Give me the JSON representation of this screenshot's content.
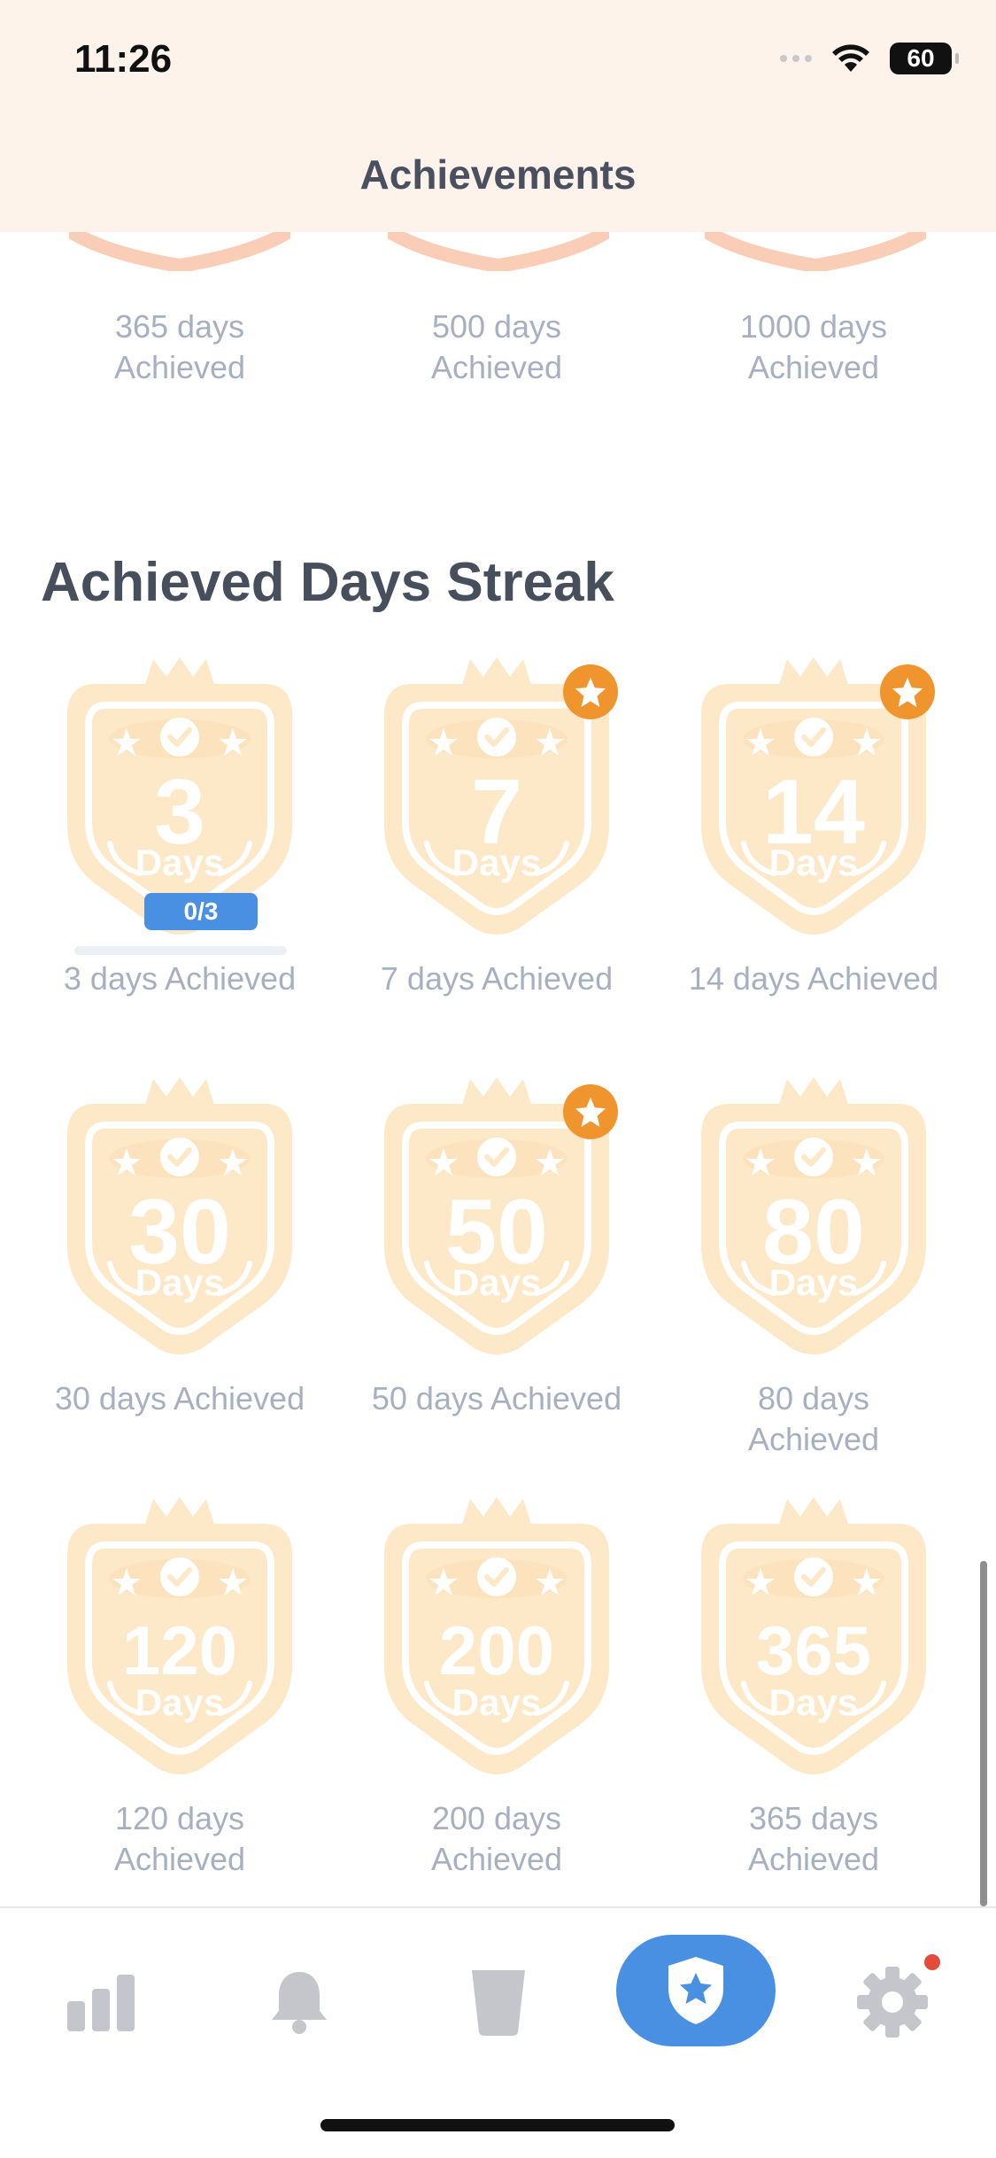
{
  "status_bar": {
    "time": "11:26",
    "battery": "60"
  },
  "header": {
    "title": "Achievements"
  },
  "previous_row": [
    {
      "label": "365 days\nAchieved"
    },
    {
      "label": "500 days\nAchieved"
    },
    {
      "label": "1000 days\nAchieved"
    }
  ],
  "section": {
    "title": "Achieved Days Streak",
    "badges": [
      {
        "number": "3",
        "unit": "Days",
        "label": "3 days Achieved",
        "starred": false,
        "progress": "0/3"
      },
      {
        "number": "7",
        "unit": "Days",
        "label": "7 days Achieved",
        "starred": true
      },
      {
        "number": "14",
        "unit": "Days",
        "label": "14 days Achieved",
        "starred": true
      },
      {
        "number": "30",
        "unit": "Days",
        "label": "30 days Achieved",
        "starred": false
      },
      {
        "number": "50",
        "unit": "Days",
        "label": "50 days Achieved",
        "starred": true
      },
      {
        "number": "80",
        "unit": "Days",
        "label": "80 days\nAchieved",
        "starred": false
      },
      {
        "number": "120",
        "unit": "Days",
        "label": "120 days\nAchieved",
        "starred": false
      },
      {
        "number": "200",
        "unit": "Days",
        "label": "200 days\nAchieved",
        "starred": false
      },
      {
        "number": "365",
        "unit": "Days",
        "label": "365 days\nAchieved",
        "starred": false
      }
    ]
  },
  "tabbar": {
    "tabs": [
      {
        "name": "stats",
        "icon": "bar-chart-icon"
      },
      {
        "name": "reminders",
        "icon": "bell-icon"
      },
      {
        "name": "drink",
        "icon": "cup-icon"
      },
      {
        "name": "achievements",
        "icon": "shield-star-icon",
        "active": true
      },
      {
        "name": "settings",
        "icon": "gear-icon",
        "badge": true
      }
    ]
  },
  "colors": {
    "badge_fill": "#fde8c8",
    "badge_stroke": "#fde0b5",
    "star_accent": "#f0952e",
    "active_tab": "#4a90e2",
    "label_text": "#a7b0c0",
    "section_title": "#474e5c"
  }
}
